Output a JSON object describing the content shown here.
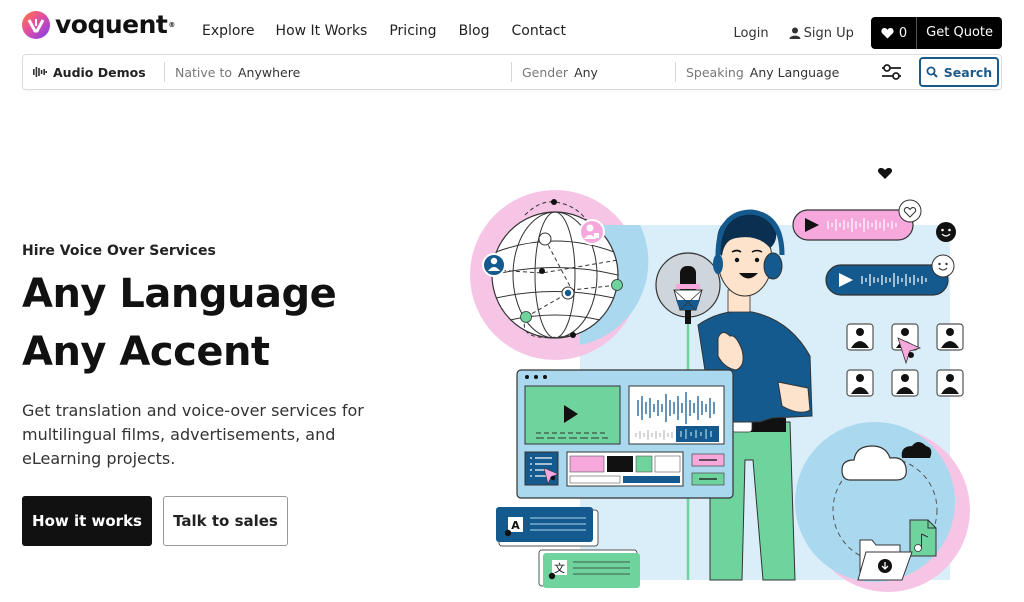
{
  "brand": {
    "name": "voquent",
    "registered_mark": "®",
    "gradient_colors": [
      "#ff7a3d",
      "#e34fa0",
      "#7b3ff2"
    ]
  },
  "nav": {
    "items": [
      {
        "label": "Explore"
      },
      {
        "label": "How It Works"
      },
      {
        "label": "Pricing"
      },
      {
        "label": "Blog"
      },
      {
        "label": "Contact"
      }
    ]
  },
  "account": {
    "login_label": "Login",
    "signup_label": "Sign Up",
    "favorites_count": "0",
    "get_quote_label": "Get Quote"
  },
  "search": {
    "audio_demos_label": "Audio Demos",
    "native_label": "Native to",
    "native_value": "Anywhere",
    "gender_label": "Gender",
    "gender_value": "Any",
    "speaking_label": "Speaking",
    "speaking_value": "Any Language",
    "search_button_label": "Search",
    "accent_color": "#1a5a8a"
  },
  "hero": {
    "eyebrow": "Hire Voice Over Services",
    "headline_line1": "Any Language",
    "headline_line2": "Any Accent",
    "description": "Get translation and voice-over services for multilingual films, advertisements, and eLearning projects.",
    "primary_button": "How it works",
    "secondary_button": "Talk to sales"
  },
  "illustration": {
    "translate_card_top_glyph": "A",
    "translate_card_bottom_glyph": "文",
    "colors": {
      "pink": "#f4a8dc",
      "light_blue": "#d9eef9",
      "mid_blue": "#a9d8ef",
      "navy": "#155a8e",
      "green": "#6fd39e",
      "skin": "#fde3cc"
    }
  }
}
